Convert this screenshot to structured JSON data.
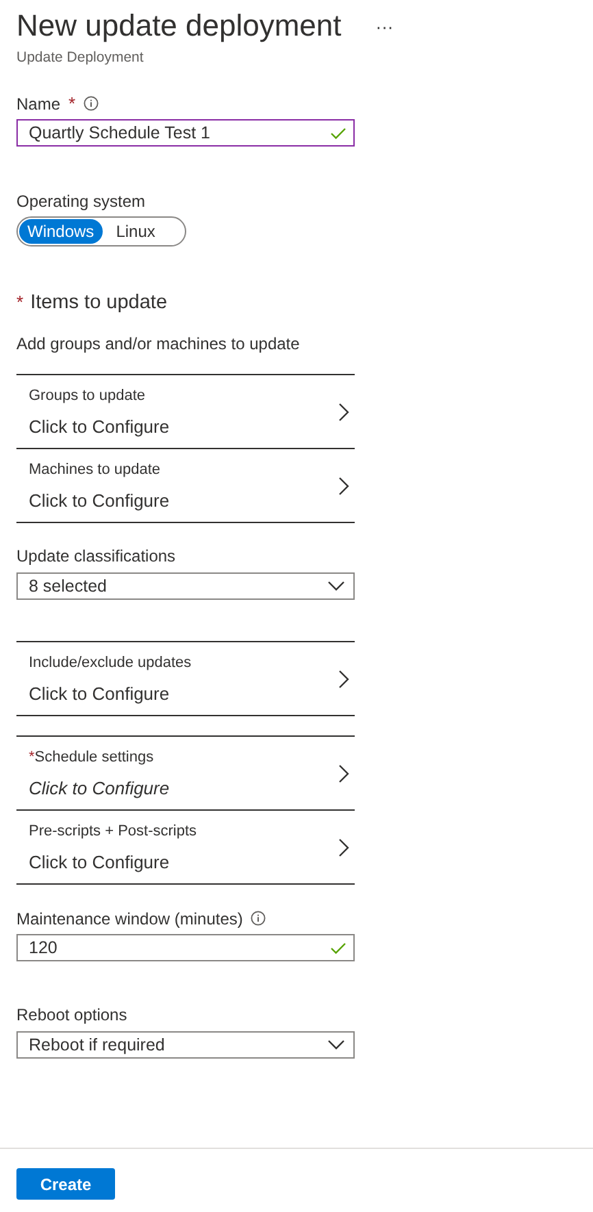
{
  "header": {
    "title": "New update deployment",
    "more_button": "···",
    "subtitle": "Update Deployment"
  },
  "fields": [
    {
      "kind": "text",
      "label": "Name",
      "required_mark": "*",
      "info": true,
      "value": "Quartly Schedule Test 1",
      "valid": true,
      "focused": true
    },
    {
      "kind": "toggle",
      "label": "Operating system",
      "options": [
        {
          "label": "Windows",
          "selected": true
        },
        {
          "label": "Linux",
          "selected": false
        }
      ]
    },
    {
      "kind": "heading",
      "label": "Items to update",
      "required_mark": "*",
      "description": "Add groups and/or machines to update"
    },
    {
      "kind": "config_group",
      "rows": [
        {
          "label": "Groups to update",
          "value": "Click to Configure",
          "pending": false
        },
        {
          "label": "Machines to update",
          "value": "Click to Configure",
          "pending": false
        }
      ]
    },
    {
      "kind": "dropdown",
      "label": "Update classifications",
      "value": "8 selected"
    },
    {
      "kind": "config_group",
      "rows": [
        {
          "label": "Include/exclude updates",
          "value": "Click to Configure",
          "pending": false
        }
      ]
    },
    {
      "kind": "config_group",
      "rows": [
        {
          "label": "Schedule settings",
          "value": "Click to Configure",
          "required_mark": "*",
          "pending": true
        },
        {
          "label": "Pre-scripts + Post-scripts",
          "value": "Click to Configure",
          "pending": false
        }
      ]
    },
    {
      "kind": "text",
      "label": "Maintenance window (minutes)",
      "info": true,
      "value": "120",
      "valid": true,
      "focused": false
    },
    {
      "kind": "dropdown",
      "label": "Reboot options",
      "value": "Reboot if required"
    }
  ],
  "footer": {
    "button": "Create"
  }
}
